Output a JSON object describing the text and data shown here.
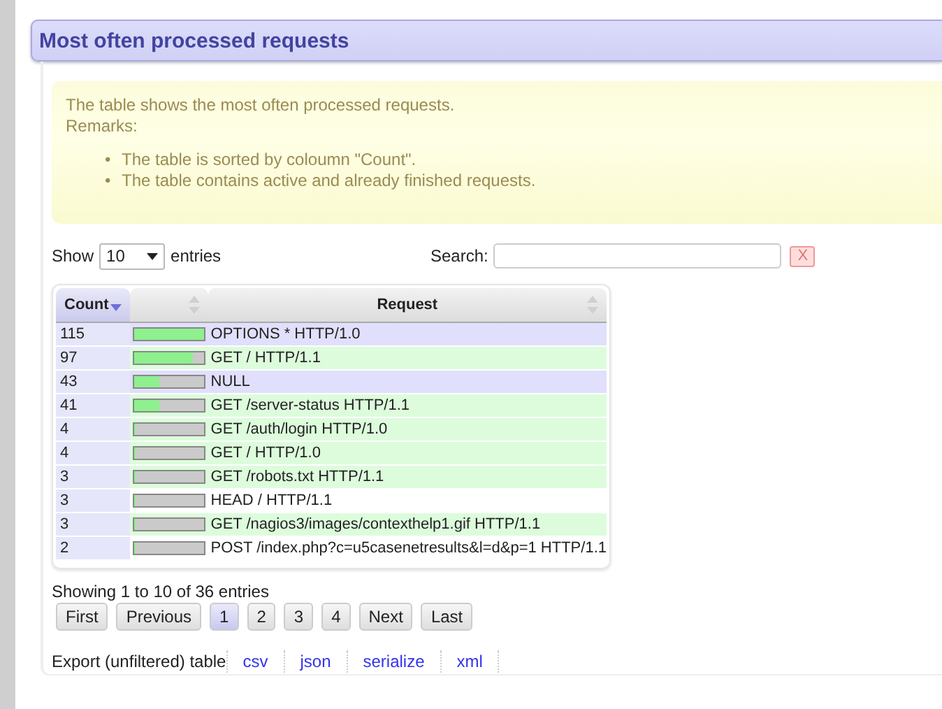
{
  "header": {
    "title": "Most often processed requests"
  },
  "notice": {
    "text": "The table shows the most often processed requests.",
    "remarks_label": "Remarks:",
    "remarks": [
      {
        "bullet": "•",
        "text": "The table is sorted by coloumn \"Count\"."
      },
      {
        "bullet": "•",
        "text": "The table contains active and already finished requests."
      }
    ]
  },
  "length": {
    "before": "Show",
    "value": "10",
    "after": "entries"
  },
  "search": {
    "label": "Search:",
    "clear": "X"
  },
  "table": {
    "columns": [
      {
        "label": "Count",
        "sorted": true
      },
      {
        "sorted": false
      },
      {
        "label": "Request",
        "sorted": false
      }
    ],
    "rows": [
      {
        "count": "115",
        "level": 1,
        "request": "OPTIONS * HTTP/1.0",
        "color": "#e0e0fc"
      },
      {
        "count": "97",
        "level": 0.84,
        "request": "GET / HTTP/1.1",
        "color": "#ddfcdc"
      },
      {
        "count": "43",
        "level": 0.37,
        "request": "NULL",
        "color": "#e0e0fc"
      },
      {
        "count": "41",
        "level": 0.36,
        "request": "GET /server-status HTTP/1.1",
        "color": "#ddfcdc"
      },
      {
        "count": "4",
        "level": 0.03,
        "request": "GET /auth/login HTTP/1.0",
        "color": "#ddfcdc"
      },
      {
        "count": "4",
        "level": 0.03,
        "request": "GET / HTTP/1.0",
        "color": "#ddfcdc"
      },
      {
        "count": "3",
        "level": 0.03,
        "request": "GET /robots.txt HTTP/1.1",
        "color": "#ddfcdc"
      },
      {
        "count": "3",
        "level": 0.03,
        "request": "HEAD / HTTP/1.1",
        "color": "#ffffff"
      },
      {
        "count": "3",
        "level": 0.03,
        "request": "GET /nagios3/images/contexthelp1.gif HTTP/1.1",
        "color": "#ddfcdc"
      },
      {
        "count": "2",
        "level": 0.02,
        "request": "POST /index.php?c=u5casenetresults&l=d&p=1 HTTP/1.1",
        "color": "#ffffff"
      }
    ]
  },
  "info": "Showing 1 to 10 of 36 entries",
  "pagination": [
    {
      "label": "First",
      "selected": false
    },
    {
      "label": "Previous",
      "selected": false
    },
    {
      "label": "1",
      "selected": true
    },
    {
      "label": "2",
      "selected": false
    },
    {
      "label": "3",
      "selected": false
    },
    {
      "label": "4",
      "selected": false
    },
    {
      "label": "Next",
      "selected": false
    },
    {
      "label": "Last",
      "selected": false
    }
  ],
  "export": {
    "label": "Export (unfiltered) table",
    "links": [
      "csv",
      "json",
      "serialize",
      "xml"
    ]
  }
}
